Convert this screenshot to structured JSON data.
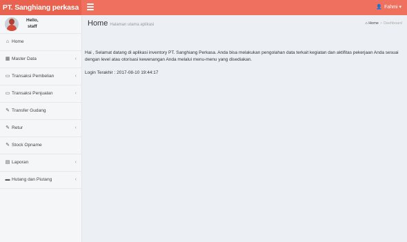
{
  "brand": "PT. Sanghiang perkasa",
  "user_menu": {
    "name": "Fahmi",
    "caret": "▾"
  },
  "user_panel": {
    "greeting": "Hello,",
    "role": "staff"
  },
  "menu": [
    {
      "label": "Home",
      "icon": "home-icon",
      "chevron": false
    },
    {
      "label": "Master Data",
      "icon": "table-icon",
      "chevron": true
    },
    {
      "label": "Transaksi Pembelian",
      "icon": "monitor-icon",
      "chevron": true
    },
    {
      "label": "Transaksi Penjualan",
      "icon": "monitor-icon",
      "chevron": true
    },
    {
      "label": "Transfer Gudang",
      "icon": "edit-icon",
      "chevron": false
    },
    {
      "label": "Retur",
      "icon": "edit-icon",
      "chevron": true
    },
    {
      "label": "Stock Opname",
      "icon": "edit-icon",
      "chevron": false
    },
    {
      "label": "Laporan",
      "icon": "chart-icon",
      "chevron": true
    },
    {
      "label": "Hutang dan Piutang",
      "icon": "folder-icon",
      "chevron": true
    }
  ],
  "header": {
    "title": "Home",
    "subtitle": "Halaman utama aplikasi"
  },
  "breadcrumb": {
    "home": "Home",
    "current": "Dashboard"
  },
  "main": {
    "welcome": "Hai , Selamat datang di aplikasi inventory PT. Sanghiang Perkasa. Anda bisa melakukan pengolahan data terkait kegiatan dan aktifitas pekerjaan Anda sesuai dengan level atau otorisasi kewenangan Anda melalui menu-menu yang disediakan.",
    "last_login_label": "Login Terakhir :",
    "last_login_value": "2017-08-10 19:44:17"
  },
  "colors": {
    "topbar": "#f0705f",
    "logo_bg": "#e9624f",
    "sidebar_bg": "#f4f6f8",
    "content_bg": "#ecf0f5"
  }
}
